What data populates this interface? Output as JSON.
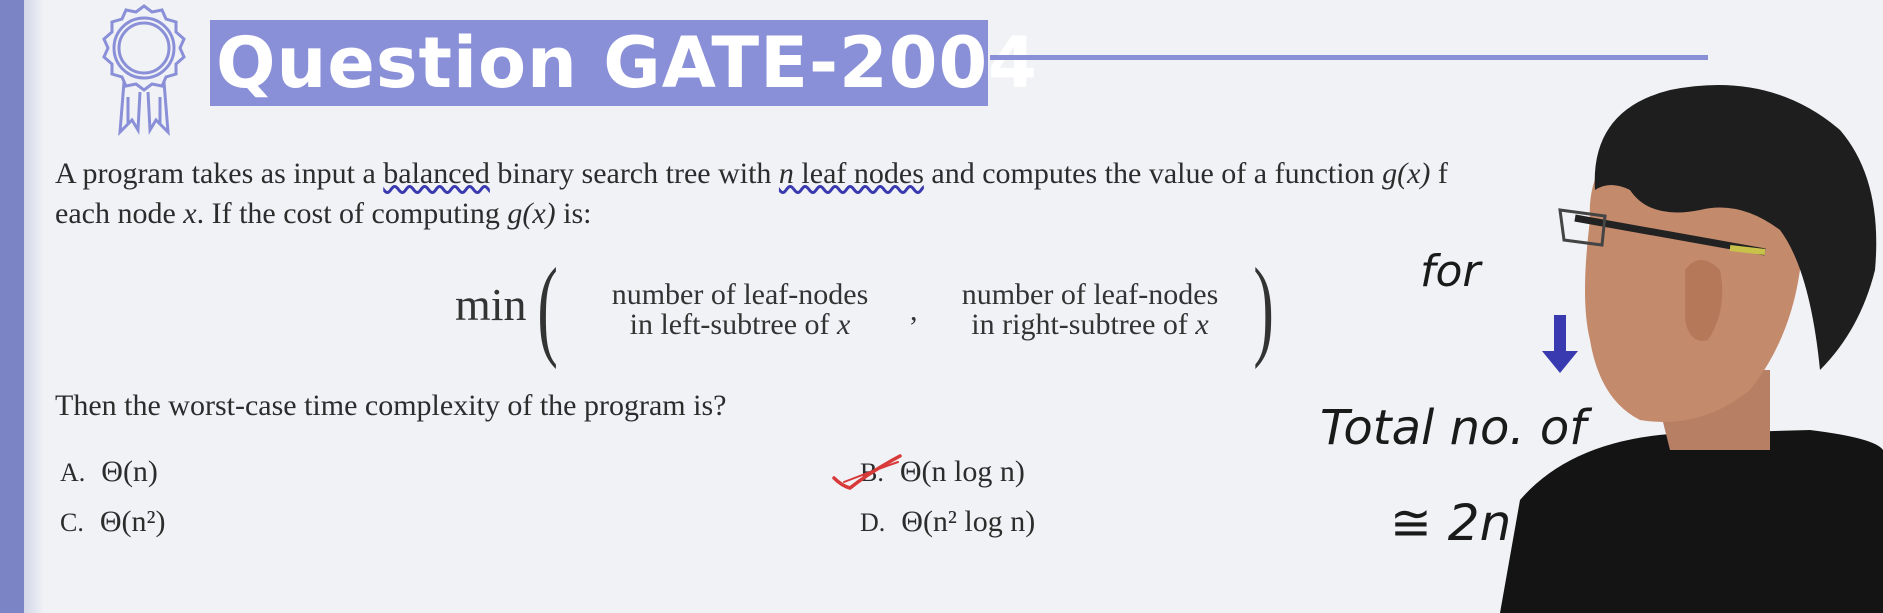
{
  "slide": {
    "title": "Question GATE-2004",
    "question_line1": {
      "pre": "A program takes as input a ",
      "balanced": "balanced",
      "mid": " binary search tree with ",
      "n": "n",
      "leaf": " leaf nodes",
      "post": " and computes the value of a function ",
      "gx": "g(x)",
      "cut": " f"
    },
    "question_line2": {
      "pre": "each node ",
      "x": "x",
      "mid": ". If the cost of computing ",
      "gx": "g(x)",
      "post": " is:"
    },
    "formula": {
      "func": "min",
      "left_num": "number of leaf-nodes",
      "left_den_pre": "in left-subtree of ",
      "right_num": "number of leaf-nodes",
      "right_den_pre": "in right-subtree of ",
      "var": "x",
      "sep": ","
    },
    "prompt": "Then the worst-case time complexity of the program is?",
    "options": [
      {
        "label": "A.",
        "text": "Θ(n)"
      },
      {
        "label": "B.",
        "text": "Θ(n log n)"
      },
      {
        "label": "C.",
        "text": "Θ(n²)"
      },
      {
        "label": "D.",
        "text": "Θ(n² log n)"
      }
    ]
  },
  "handwriting": {
    "line1": "for",
    "line2": "Total no. of",
    "line3": "≅ 2n"
  },
  "colors": {
    "accent": "#8a90d8",
    "left_bar": "#7b84c4",
    "annotation": "#3a3ab0",
    "checkmark": "#d83a3a"
  }
}
